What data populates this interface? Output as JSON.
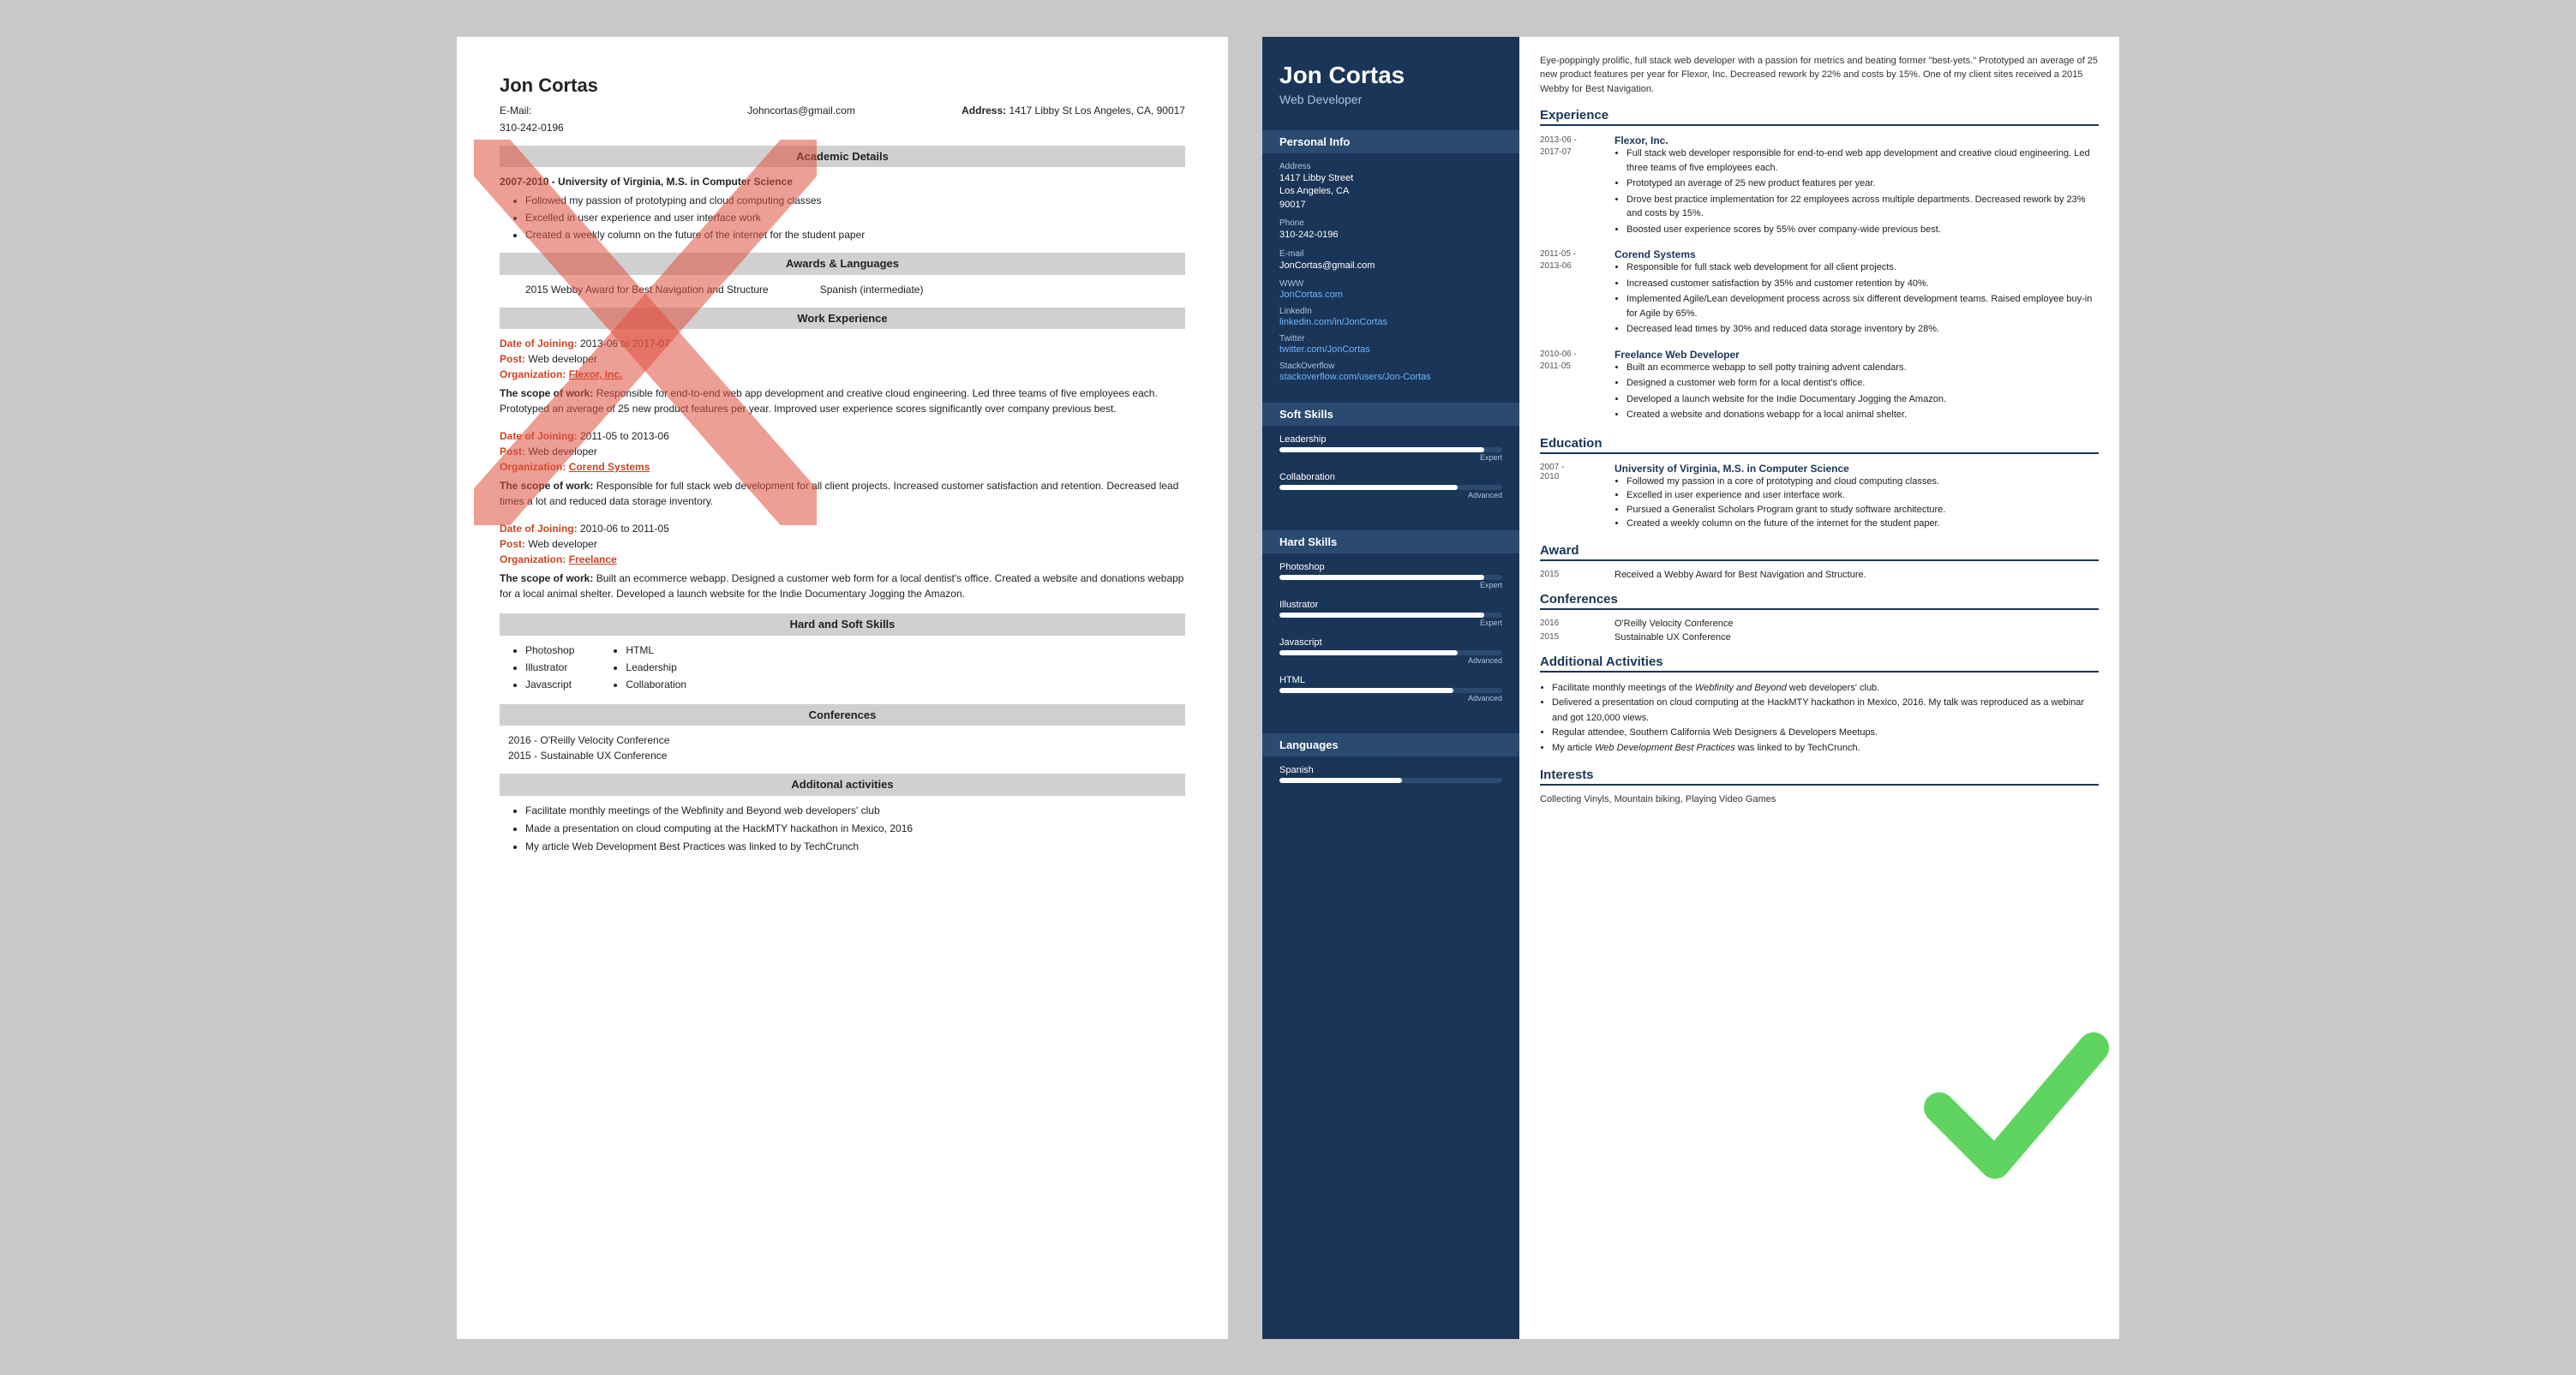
{
  "left": {
    "name": "Jon Cortas",
    "email_label": "E-Mail:",
    "email": "Johncortas@gmail.com",
    "address_label": "Address:",
    "address": "1417 Libby St Los Angeles, CA, 90017",
    "phone": "310-242-0196",
    "academic_title": "Academic Details",
    "academic_entry": "2007-2010 - University of Virginia, M.S. in Computer Science",
    "academic_bullets": [
      "Followed my passion of prototyping and cloud computing classes",
      "Excelled in user experience and user interface work",
      "Created a weekly column on the future of the internet for the student paper"
    ],
    "awards_title": "Awards & Languages",
    "award1": "2015 Webby Award for Best Navigation and Structure",
    "award2": "Spanish (intermediate)",
    "work_title": "Work Experience",
    "work_entries": [
      {
        "date": "2013-06 to 2017-07",
        "post": "Web developer",
        "org": "Flexor, Inc.",
        "scope": "The scope of work: Responsible for end-to-end web app development and creative cloud engineering. Led three teams of five employees each. Prototyped an average of 25 new product features per year. Improved user experience scores significantly over company previous best."
      },
      {
        "date": "2011-05 to 2013-06",
        "post": "Web developer",
        "org": "Corend Systems",
        "scope": "The scope of work: Responsible for full stack web development for all client projects. Increased customer satisfaction and retention. Decreased lead times a lot and reduced data storage inventory."
      },
      {
        "date": "2010-06 to 2011-05",
        "post": "Web developer",
        "org": "Freelance",
        "scope": "The scope of work: Built an ecommerce webapp. Designed a customer web form for a local dentist's office. Created a website and donations webapp for a local animal shelter. Developed a launch website for the Indie Documentary Jogging the Amazon."
      }
    ],
    "skills_title": "Hard and Soft Skills",
    "skills": [
      "Photoshop",
      "Illustrator",
      "Javascript",
      "HTML",
      "Leadership",
      "Collaboration"
    ],
    "conferences_title": "Conferences",
    "conferences": [
      "2016 - O'Reilly Velocity Conference",
      "2015 - Sustainable UX Conference"
    ],
    "activities_title": "Additonal activities",
    "activities": [
      "Facilitate monthly meetings of the Webfinity and Beyond web developers' club",
      "Made a presentation on cloud computing at the HackMTY hackathon in Mexico, 2016",
      "My article Web Development Best Practices was linked to by TechCrunch"
    ]
  },
  "right": {
    "name": "Jon Cortas",
    "title": "Web Developer",
    "summary": "Eye-poppingly prolific, full stack web developer with a passion for metrics and beating former \"best-yets.\" Prototyped an average of 25 new product features per year for Flexor, Inc. Decreased rework by 22% and costs by 15%. One of my client sites received a 2015 Webby for Best Navigation.",
    "personal_info_title": "Personal Info",
    "address_label": "Address",
    "address_lines": [
      "1417 Libby Street",
      "Los Angeles, CA",
      "90017"
    ],
    "phone_label": "Phone",
    "phone": "310-242-0196",
    "email_label": "E-mail",
    "email": "JonCortas@gmail.com",
    "www_label": "WWW",
    "www": "JonCortas.com",
    "linkedin_label": "LinkedIn",
    "linkedin": "linkedin.com/in/JonCortas",
    "twitter_label": "Twitter",
    "twitter": "twitter.com/JonCortas",
    "stackoverflow_label": "StackOverflow",
    "stackoverflow": "stackoverflow.com/users/Jon-Cortas",
    "soft_skills_title": "Soft Skills",
    "soft_skills": [
      {
        "name": "Leadership",
        "pct": 92,
        "level": "Expert"
      },
      {
        "name": "Collaboration",
        "pct": 80,
        "level": "Advanced"
      }
    ],
    "hard_skills_title": "Hard Skills",
    "hard_skills": [
      {
        "name": "Photoshop",
        "pct": 92,
        "level": "Expert"
      },
      {
        "name": "Illustrator",
        "pct": 92,
        "level": "Expert"
      },
      {
        "name": "Javascript",
        "pct": 80,
        "level": "Advanced"
      },
      {
        "name": "HTML",
        "pct": 78,
        "level": "Advanced"
      }
    ],
    "languages_title": "Languages",
    "languages": [
      {
        "name": "Spanish",
        "pct": 55,
        "level": ""
      }
    ],
    "experience_title": "Experience",
    "experience": [
      {
        "dates": "2013-06 -\n2017-07",
        "company": "Flexor, Inc.",
        "bullets": [
          "Full stack web developer responsible for end-to-end web app development and creative cloud engineering. Led three teams of five employees each.",
          "Prototyped an average of 25 new product features per year.",
          "Drove best practice implementation for 22 employees across multiple departments. Decreased rework by 23% and costs by 15%.",
          "Boosted user experience scores by 55% over company-wide previous best."
        ]
      },
      {
        "dates": "2011-05 -\n2013-06",
        "company": "Corend Systems",
        "bullets": [
          "Responsible for full stack web development for all client projects.",
          "Increased customer satisfaction by 35% and customer retention by 40%.",
          "Implemented Agile/Lean development process across six different development teams. Raised employee buy-in for Agile by 65%.",
          "Decreased lead times by 30% and reduced data storage inventory by 28%."
        ]
      },
      {
        "dates": "2010-06 -\n2011-05",
        "company": "Freelance Web Developer",
        "bullets": [
          "Built an ecommerce webapp to sell potty training advent calendars.",
          "Designed a customer web form for a local dentist's office.",
          "Developed a launch website for the Indie Documentary Jogging the Amazon.",
          "Created a website and donations webapp for a local animal shelter."
        ]
      }
    ],
    "education_title": "Education",
    "education": [
      {
        "dates": "2007 -\n2010",
        "school": "University of Virginia, M.S. in Computer Science",
        "bullets": [
          "Followed my passion in a core of prototyping and cloud computing classes.",
          "Excelled in user experience and user interface work.",
          "Pursued a Generalist Scholars Program grant to study software architecture.",
          "Created a weekly column on the future of the internet for the student paper."
        ]
      }
    ],
    "award_title": "Award",
    "award_year": "2015",
    "award_text": "Received a Webby Award for Best Navigation and Structure.",
    "conferences_title": "Conferences",
    "conferences": [
      {
        "year": "2016",
        "name": "O'Reilly Velocity Conference"
      },
      {
        "year": "2015",
        "name": "Sustainable UX Conference"
      }
    ],
    "activities_title": "Additional Activities",
    "activities": [
      "Facilitate monthly meetings of the Webfinity and Beyond web developers' club.",
      "Delivered a presentation on cloud computing at the HackMTY hackathon in Mexico, 2016. My talk was reproduced as a webinar and got 120,000 views.",
      "Regular attendee, Southern California Web Designers & Developers Meetups.",
      "My article Web Development Best Practices was linked to by TechCrunch."
    ],
    "interests_title": "Interests",
    "interests": "Collecting Vinyls, Mountain biking, Playing Video Games"
  }
}
